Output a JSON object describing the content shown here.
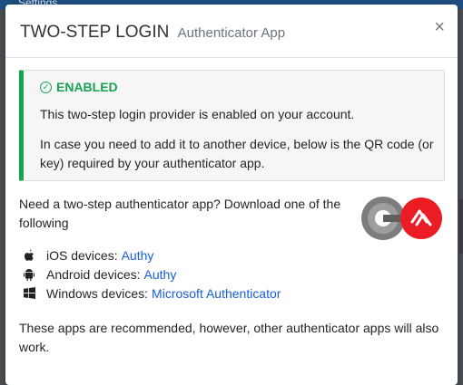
{
  "background": {
    "header_text": "Settings"
  },
  "modal": {
    "title": "TWO-STEP LOGIN",
    "subtitle": "Authenticator App",
    "close_symbol": "×"
  },
  "alert": {
    "status": "ENABLED",
    "line1": "This two-step login provider is enabled on your account.",
    "line2": "In case you need to add it to another device, below is the QR code (or key) required by your authenticator app."
  },
  "apps": {
    "intro": "Need a two-step authenticator app? Download one of the following",
    "devices": [
      {
        "label": "iOS devices:",
        "link": "Authy",
        "icon": "apple-icon"
      },
      {
        "label": "Android devices:",
        "link": "Authy",
        "icon": "android-icon"
      },
      {
        "label": "Windows devices:",
        "link": "Microsoft Authenticator",
        "icon": "windows-icon"
      }
    ],
    "note": "These apps are recommended, however, other authenticator apps will also work."
  },
  "colors": {
    "success": "#17a354",
    "link": "#175ddc",
    "authy_red": "#ec1c24"
  }
}
